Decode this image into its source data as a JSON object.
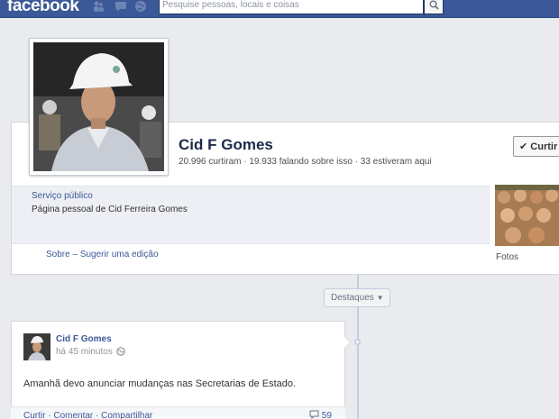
{
  "topbar": {
    "logo": "facebook",
    "search_placeholder": "Pesquise pessoas, locais e coisas"
  },
  "icons": {
    "friend_requests": "friends-icon",
    "messages": "messages-icon",
    "notifications": "globe-icon",
    "search": "search-icon"
  },
  "page": {
    "name": "Cid F Gomes",
    "stats": "20.996 curtiram · 19.933 falando sobre isso · 33 estiveram aqui",
    "like_button": "Curtir",
    "category": "Serviço público",
    "about": "Página pessoal de Cid Ferreira Gomes",
    "about_link": "Sobre",
    "suggest_link": "Sugerir uma edição",
    "photos_label": "Fotos"
  },
  "timeline": {
    "highlights_label": "Destaques"
  },
  "post": {
    "author": "Cid F Gomes",
    "time": "há 45 minutos",
    "text": "Amanhã devo anunciar mudanças nas Secretarias de Estado.",
    "actions": [
      "Curtir",
      "Comentar",
      "Compartilhar"
    ],
    "comment_count": "59"
  },
  "colors": {
    "brand": "#3b5998",
    "background": "#e9ebee"
  }
}
